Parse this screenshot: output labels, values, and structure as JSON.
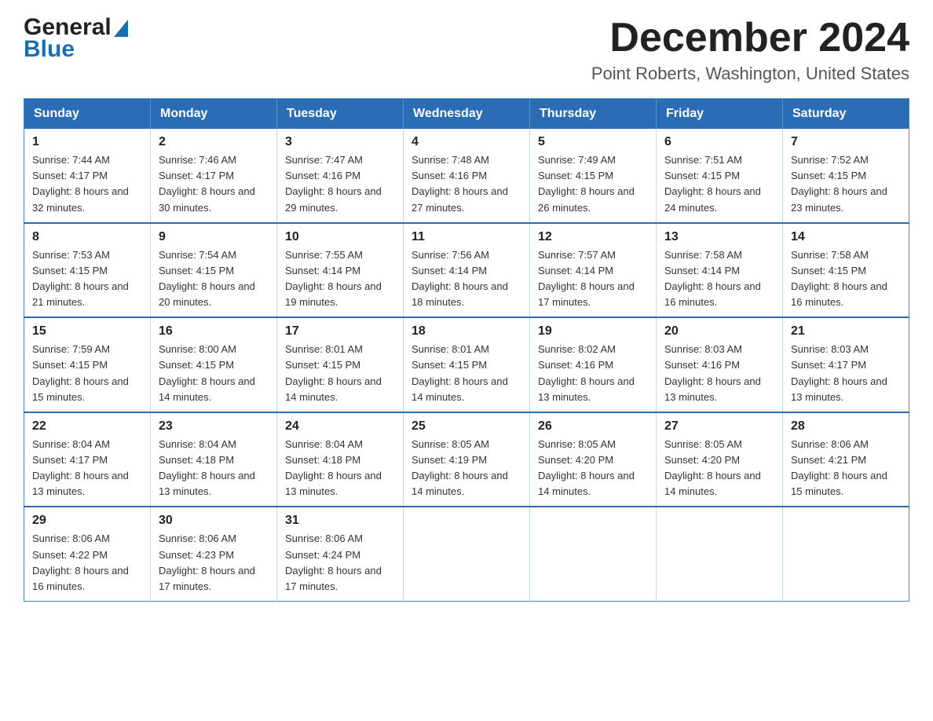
{
  "header": {
    "logo": {
      "general": "General",
      "blue": "Blue"
    },
    "title": "December 2024",
    "location": "Point Roberts, Washington, United States"
  },
  "weekdays": [
    "Sunday",
    "Monday",
    "Tuesday",
    "Wednesday",
    "Thursday",
    "Friday",
    "Saturday"
  ],
  "weeks": [
    [
      {
        "day": "1",
        "sunrise": "7:44 AM",
        "sunset": "4:17 PM",
        "daylight": "8 hours and 32 minutes."
      },
      {
        "day": "2",
        "sunrise": "7:46 AM",
        "sunset": "4:17 PM",
        "daylight": "8 hours and 30 minutes."
      },
      {
        "day": "3",
        "sunrise": "7:47 AM",
        "sunset": "4:16 PM",
        "daylight": "8 hours and 29 minutes."
      },
      {
        "day": "4",
        "sunrise": "7:48 AM",
        "sunset": "4:16 PM",
        "daylight": "8 hours and 27 minutes."
      },
      {
        "day": "5",
        "sunrise": "7:49 AM",
        "sunset": "4:15 PM",
        "daylight": "8 hours and 26 minutes."
      },
      {
        "day": "6",
        "sunrise": "7:51 AM",
        "sunset": "4:15 PM",
        "daylight": "8 hours and 24 minutes."
      },
      {
        "day": "7",
        "sunrise": "7:52 AM",
        "sunset": "4:15 PM",
        "daylight": "8 hours and 23 minutes."
      }
    ],
    [
      {
        "day": "8",
        "sunrise": "7:53 AM",
        "sunset": "4:15 PM",
        "daylight": "8 hours and 21 minutes."
      },
      {
        "day": "9",
        "sunrise": "7:54 AM",
        "sunset": "4:15 PM",
        "daylight": "8 hours and 20 minutes."
      },
      {
        "day": "10",
        "sunrise": "7:55 AM",
        "sunset": "4:14 PM",
        "daylight": "8 hours and 19 minutes."
      },
      {
        "day": "11",
        "sunrise": "7:56 AM",
        "sunset": "4:14 PM",
        "daylight": "8 hours and 18 minutes."
      },
      {
        "day": "12",
        "sunrise": "7:57 AM",
        "sunset": "4:14 PM",
        "daylight": "8 hours and 17 minutes."
      },
      {
        "day": "13",
        "sunrise": "7:58 AM",
        "sunset": "4:14 PM",
        "daylight": "8 hours and 16 minutes."
      },
      {
        "day": "14",
        "sunrise": "7:58 AM",
        "sunset": "4:15 PM",
        "daylight": "8 hours and 16 minutes."
      }
    ],
    [
      {
        "day": "15",
        "sunrise": "7:59 AM",
        "sunset": "4:15 PM",
        "daylight": "8 hours and 15 minutes."
      },
      {
        "day": "16",
        "sunrise": "8:00 AM",
        "sunset": "4:15 PM",
        "daylight": "8 hours and 14 minutes."
      },
      {
        "day": "17",
        "sunrise": "8:01 AM",
        "sunset": "4:15 PM",
        "daylight": "8 hours and 14 minutes."
      },
      {
        "day": "18",
        "sunrise": "8:01 AM",
        "sunset": "4:15 PM",
        "daylight": "8 hours and 14 minutes."
      },
      {
        "day": "19",
        "sunrise": "8:02 AM",
        "sunset": "4:16 PM",
        "daylight": "8 hours and 13 minutes."
      },
      {
        "day": "20",
        "sunrise": "8:03 AM",
        "sunset": "4:16 PM",
        "daylight": "8 hours and 13 minutes."
      },
      {
        "day": "21",
        "sunrise": "8:03 AM",
        "sunset": "4:17 PM",
        "daylight": "8 hours and 13 minutes."
      }
    ],
    [
      {
        "day": "22",
        "sunrise": "8:04 AM",
        "sunset": "4:17 PM",
        "daylight": "8 hours and 13 minutes."
      },
      {
        "day": "23",
        "sunrise": "8:04 AM",
        "sunset": "4:18 PM",
        "daylight": "8 hours and 13 minutes."
      },
      {
        "day": "24",
        "sunrise": "8:04 AM",
        "sunset": "4:18 PM",
        "daylight": "8 hours and 13 minutes."
      },
      {
        "day": "25",
        "sunrise": "8:05 AM",
        "sunset": "4:19 PM",
        "daylight": "8 hours and 14 minutes."
      },
      {
        "day": "26",
        "sunrise": "8:05 AM",
        "sunset": "4:20 PM",
        "daylight": "8 hours and 14 minutes."
      },
      {
        "day": "27",
        "sunrise": "8:05 AM",
        "sunset": "4:20 PM",
        "daylight": "8 hours and 14 minutes."
      },
      {
        "day": "28",
        "sunrise": "8:06 AM",
        "sunset": "4:21 PM",
        "daylight": "8 hours and 15 minutes."
      }
    ],
    [
      {
        "day": "29",
        "sunrise": "8:06 AM",
        "sunset": "4:22 PM",
        "daylight": "8 hours and 16 minutes."
      },
      {
        "day": "30",
        "sunrise": "8:06 AM",
        "sunset": "4:23 PM",
        "daylight": "8 hours and 17 minutes."
      },
      {
        "day": "31",
        "sunrise": "8:06 AM",
        "sunset": "4:24 PM",
        "daylight": "8 hours and 17 minutes."
      },
      null,
      null,
      null,
      null
    ]
  ]
}
